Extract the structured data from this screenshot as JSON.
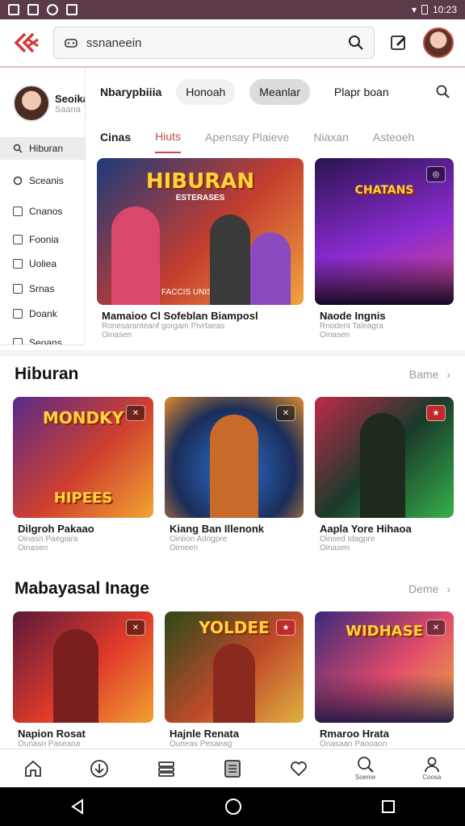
{
  "status_bar": {
    "time": "10:23"
  },
  "topbar": {
    "search_text": "ssnaneein"
  },
  "sidebar": {
    "profile": {
      "name": "Seoika",
      "subtitle": "Saana"
    },
    "items": [
      {
        "label": "Hiburan",
        "icon": "search-icon",
        "active": true
      },
      {
        "label": "Sceanis",
        "icon": "refresh-icon",
        "active": false
      },
      {
        "label": "Cnanos",
        "icon": "square-icon",
        "active": false
      },
      {
        "label": "Foonia",
        "icon": "square-icon",
        "active": false
      },
      {
        "label": "Uoliea",
        "icon": "square-icon",
        "active": false
      },
      {
        "label": "Srnas",
        "icon": "square-icon",
        "active": false
      },
      {
        "label": "Doank",
        "icon": "square-icon",
        "active": false
      },
      {
        "label": "Seoans",
        "icon": "square-icon",
        "active": false
      }
    ]
  },
  "top_nav": {
    "title": "Nbarypbiiia",
    "pills": [
      {
        "label": "Honoah",
        "active": false
      },
      {
        "label": "Meanlar",
        "active": true
      },
      {
        "label": "Plapr boan",
        "active": false
      }
    ]
  },
  "sub_tabs": [
    {
      "label": "Cinas",
      "state": "first"
    },
    {
      "label": "Hiuts",
      "state": "active"
    },
    {
      "label": "Apensay Plaieve",
      "state": ""
    },
    {
      "label": "Niaxan",
      "state": ""
    },
    {
      "label": "Asteoeh",
      "state": ""
    }
  ],
  "featured": [
    {
      "art_title": "HIBURAN",
      "art_sub": "ESTERASES",
      "caption": "FACCIS UNIS",
      "title": "Mamaioo Cl Sofeblan Biamposl",
      "sub1": "Ronesaranteanf gorgam Pivrtaeas",
      "sub2": "Oinasen",
      "colors": [
        "#1e3a7a",
        "#c43d2f",
        "#f2a33c"
      ]
    },
    {
      "art_title": "CHATANS",
      "art_sub": "",
      "title": "Naode Ingnis",
      "sub1": "Rnodent Taleagra",
      "sub2": "Oinasen",
      "colors": [
        "#2a1450",
        "#8a2bd0",
        "#e04a8a"
      ]
    }
  ],
  "section1": {
    "title": "Hiburan",
    "more": "Bame",
    "cards": [
      {
        "art_title": "MONDKY",
        "art_bottom": "HIPEES",
        "title": "Dilgroh Pakaao",
        "sub1": "Oinasn Paegiara",
        "sub2": "Oinasen",
        "colors": [
          "#5a2a8a",
          "#d0402e",
          "#f0a532"
        ]
      },
      {
        "art_title": "",
        "art_bottom": "",
        "title": "Kiang Ban Illenonk",
        "sub1": "Oinlion Adogpre",
        "sub2": "Oimeen",
        "colors": [
          "#1a2e5a",
          "#2f6fd0",
          "#e08a2a"
        ]
      },
      {
        "art_title": "",
        "art_bottom": "",
        "title": "Aapla Yore Hihaoa",
        "sub1": "Oinsed Idagpre",
        "sub2": "Oinasen",
        "colors": [
          "#1a3a2a",
          "#36b04a",
          "#c02a4a"
        ]
      }
    ]
  },
  "section2": {
    "title": "Mabayasal Inage",
    "more": "Deme",
    "cards": [
      {
        "art_title": "",
        "title": "Napion Rosat",
        "sub1": "Ounasn Paseana",
        "colors": [
          "#5a1a3a",
          "#e03a2a",
          "#f0a030"
        ]
      },
      {
        "art_title": "YOLDEE",
        "title": "Hajnle Renata",
        "sub1": "Ouneas Pesaeag",
        "colors": [
          "#2a4a1a",
          "#c04a2a",
          "#e0b040"
        ]
      },
      {
        "art_title": "WIDHASE",
        "title": "Rmaroo Hrata",
        "sub1": "Onasaan Paooaon",
        "colors": [
          "#3a2a7a",
          "#e04a6a",
          "#f0b040"
        ]
      }
    ]
  },
  "bottom_nav": [
    {
      "name": "home",
      "label": ""
    },
    {
      "name": "download",
      "label": ""
    },
    {
      "name": "list",
      "label": ""
    },
    {
      "name": "library",
      "label": ""
    },
    {
      "name": "favorite",
      "label": ""
    },
    {
      "name": "search",
      "label": "Soeme"
    },
    {
      "name": "profile",
      "label": "Coosa"
    }
  ],
  "theme": {
    "accent": "#c94a4a",
    "statusbar": "#5b3a4a"
  }
}
